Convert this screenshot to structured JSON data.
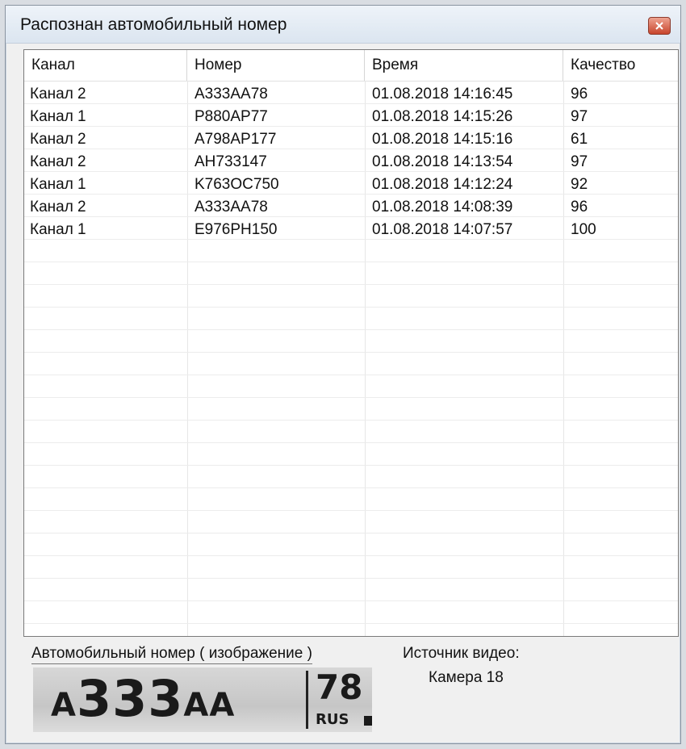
{
  "window": {
    "title": "Распознан автомобильный номер"
  },
  "table": {
    "columns": [
      "Канал",
      "Номер",
      "Время",
      "Качество"
    ],
    "rows": [
      [
        "Канал 2",
        "A333AA78",
        "01.08.2018 14:16:45",
        "96"
      ],
      [
        "Канал 1",
        "P880AP77",
        "01.08.2018 14:15:26",
        "97"
      ],
      [
        "Канал 2",
        "A798AP177",
        "01.08.2018 14:15:16",
        "61"
      ],
      [
        "Канал 2",
        "AH733147",
        "01.08.2018 14:13:54",
        "97"
      ],
      [
        "Канал 1",
        "K763OC750",
        "01.08.2018 14:12:24",
        "92"
      ],
      [
        "Канал 2",
        "A333AA78",
        "01.08.2018 14:08:39",
        "96"
      ],
      [
        "Канал 1",
        "E976PH150",
        "01.08.2018 14:07:57",
        "100"
      ]
    ]
  },
  "plate": {
    "label": "Автомобильный номер ( изображение )",
    "series_letter": "A",
    "digits": "333",
    "letters": "AA",
    "region": "78",
    "country": "RUS"
  },
  "source": {
    "title": "Источник видео:",
    "value": "Камера 18"
  },
  "colors": {
    "close_button": "#c8452d",
    "titlebar": "#dbe5f0"
  }
}
